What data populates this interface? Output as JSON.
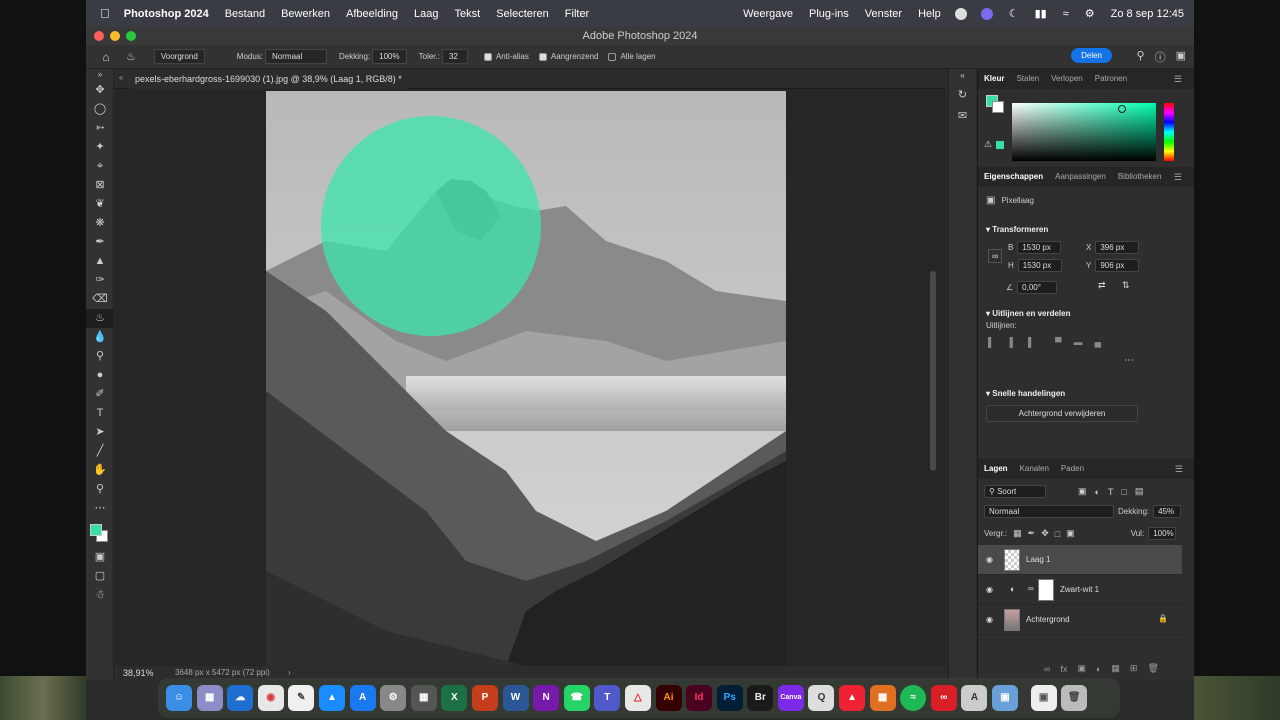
{
  "menubar": {
    "app": "Photoshop 2024",
    "items": [
      "Bestand",
      "Bewerken",
      "Afbeelding",
      "Laag",
      "Tekst",
      "Selecteren",
      "Filter"
    ],
    "right_items": [
      "Weergave",
      "Plug-ins",
      "Venster",
      "Help"
    ],
    "clock": "Zo 8 sep  12:45"
  },
  "window": {
    "title": "Adobe Photoshop 2024"
  },
  "options": {
    "preset": "Voorgrond",
    "mode_label": "Modus:",
    "mode_value": "Normaal",
    "opacity_label": "Dekking:",
    "opacity_value": "100%",
    "tolerance_label": "Toler.:",
    "tolerance_value": "32",
    "antialias_label": "Anti-alias",
    "contiguous_label": "Aangrenzend",
    "all_layers_label": "Alle lagen",
    "share_label": "Delen"
  },
  "document": {
    "tab_title": "pexels-eberhardgross-1699030 (1).jpg @ 38,9% (Laag 1, RGB/8) *",
    "zoom": "38,91%",
    "dimensions": "3648 px x 5472 px (72 ppi)"
  },
  "colors": {
    "foreground": "#39e0a4",
    "background": "#ffffff",
    "accent": "#1473e6",
    "overlay": "#3ce6aa"
  },
  "panel_color": {
    "tabs": [
      "Kleur",
      "Stalen",
      "Verlopen",
      "Patronen"
    ]
  },
  "panel_properties": {
    "tabs": [
      "Eigenschappen",
      "Aanpassingen",
      "Bibliotheken"
    ],
    "layer_type": "Pixellaag",
    "transform_title": "Transformeren",
    "w_label": "B",
    "w_value": "1530 px",
    "h_label": "H",
    "h_value": "1530 px",
    "x_label": "X",
    "x_value": "396 px",
    "y_label": "Y",
    "y_value": "906 px",
    "angle_value": "0,00°",
    "align_title": "Uitlijnen en verdelen",
    "align_label": "Uitlijnen:",
    "quick_title": "Snelle handelingen",
    "remove_bg": "Achtergrond verwijderen"
  },
  "panel_layers": {
    "tabs": [
      "Lagen",
      "Kanalen",
      "Paden"
    ],
    "filter": "Soort",
    "blend": "Normaal",
    "opacity_label": "Dekking:",
    "opacity_value": "45%",
    "lock_label": "Vergr.:",
    "fill_label": "Vul:",
    "fill_value": "100%",
    "layers": [
      {
        "name": "Laag 1"
      },
      {
        "name": "Zwart-wit 1"
      },
      {
        "name": "Achtergrond"
      }
    ]
  },
  "dock": {
    "apps": [
      "finder-icon",
      "launchpad-icon",
      "onedrive-icon",
      "chrome-icon",
      "textedit-icon",
      "keynote-icon",
      "appstore-icon",
      "settings-icon",
      "calculator-icon",
      "excel-icon",
      "powerpoint-icon",
      "word-icon",
      "onenote-icon",
      "whatsapp-icon",
      "teams-icon",
      "acrobat-icon",
      "illustrator-icon",
      "indesign-icon",
      "photoshop-icon",
      "bridge-icon",
      "canva-icon",
      "quicktime-icon",
      "affinity-icon",
      "books-icon",
      "spotify-icon",
      "creative-cloud-icon",
      "preview-icon",
      "finder2-icon",
      "photos-icon",
      "trash-icon"
    ],
    "labels": {
      "illustrator": "Ai",
      "indesign": "Id",
      "photoshop": "Ps",
      "bridge": "Br",
      "canva": "Canva"
    }
  }
}
